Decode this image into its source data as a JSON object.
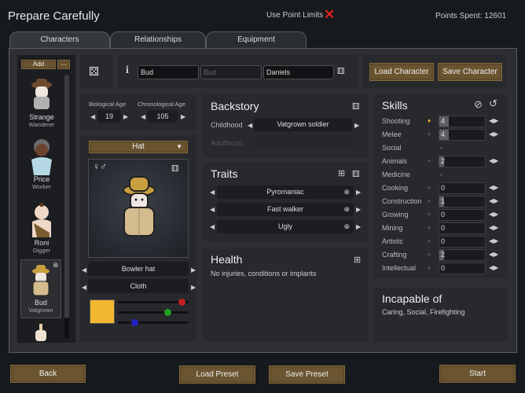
{
  "header": {
    "title": "Prepare Carefully",
    "use_point_limits": "Use Point Limits",
    "point_limits_icon": "✕",
    "points_spent": "Points Spent: 12601"
  },
  "tabs": [
    {
      "label": "Characters",
      "active": true
    },
    {
      "label": "Relationships",
      "active": false
    },
    {
      "label": "Equipment",
      "active": false
    }
  ],
  "pawn_list": {
    "add_label": "Add",
    "more_label": "...",
    "pawns": [
      {
        "name": "Strange",
        "role": "Wanderer"
      },
      {
        "name": "Price",
        "role": "Worker"
      },
      {
        "name": "Roni",
        "role": "Digger"
      },
      {
        "name": "Bud",
        "role": "Vatgrown",
        "selected": true
      }
    ]
  },
  "name": {
    "first": "Bud",
    "nick_placeholder": "Bud",
    "last": "Daniels"
  },
  "character_buttons": {
    "load": "Load Character",
    "save": "Save Character"
  },
  "age": {
    "bio_label": "Biological Age",
    "bio_value": "19",
    "chrono_label": "Chronological Age",
    "chrono_value": "105"
  },
  "appearance": {
    "layer": "Hat",
    "gender_icons": "♀♂",
    "apparel": "Bowler hat",
    "material": "Cloth",
    "color": "#f4b731",
    "color_rgb": {
      "r": 0.92,
      "g": 0.7,
      "b": 0.2
    }
  },
  "backstory": {
    "title": "Backstory",
    "childhood_label": "Childhood",
    "childhood_value": "Vatgrown soldier",
    "adulthood_label": "Adulthood",
    "adulthood_value": ""
  },
  "traits": {
    "title": "Traits",
    "items": [
      "Pyromaniac",
      "Fast walker",
      "Ugly"
    ]
  },
  "health": {
    "title": "Health",
    "text": "No injuries, conditions or implants"
  },
  "skills": {
    "title": "Skills",
    "items": [
      {
        "name": "Shooting",
        "value": "4",
        "passion": "minor",
        "level": 4
      },
      {
        "name": "Melee",
        "value": "4",
        "passion": "none",
        "level": 4
      },
      {
        "name": "Social",
        "value": "-",
        "disabled": true
      },
      {
        "name": "Animals",
        "value": "2",
        "passion": "none",
        "level": 2
      },
      {
        "name": "Medicine",
        "value": "-",
        "disabled": true
      },
      {
        "name": "Cooking",
        "value": "0",
        "passion": "none",
        "level": 0
      },
      {
        "name": "Construction",
        "value": "1",
        "passion": "none",
        "level": 1
      },
      {
        "name": "Growing",
        "value": "0",
        "passion": "none",
        "level": 0
      },
      {
        "name": "Mining",
        "value": "0",
        "passion": "none",
        "level": 0
      },
      {
        "name": "Artistic",
        "value": "0",
        "passion": "none",
        "level": 0
      },
      {
        "name": "Crafting",
        "value": "2",
        "passion": "none",
        "level": 2
      },
      {
        "name": "Intellectual",
        "value": "0",
        "passion": "none",
        "level": 0
      }
    ]
  },
  "incapable": {
    "title": "Incapable of",
    "text": "Caring, Social, Firefighting"
  },
  "footer": {
    "back": "Back",
    "load_preset": "Load Preset",
    "save_preset": "Save Preset",
    "start": "Start"
  },
  "colors": {
    "accent_button": "#6b5531",
    "x_red": "#e02020",
    "passion": "#f0b020"
  }
}
